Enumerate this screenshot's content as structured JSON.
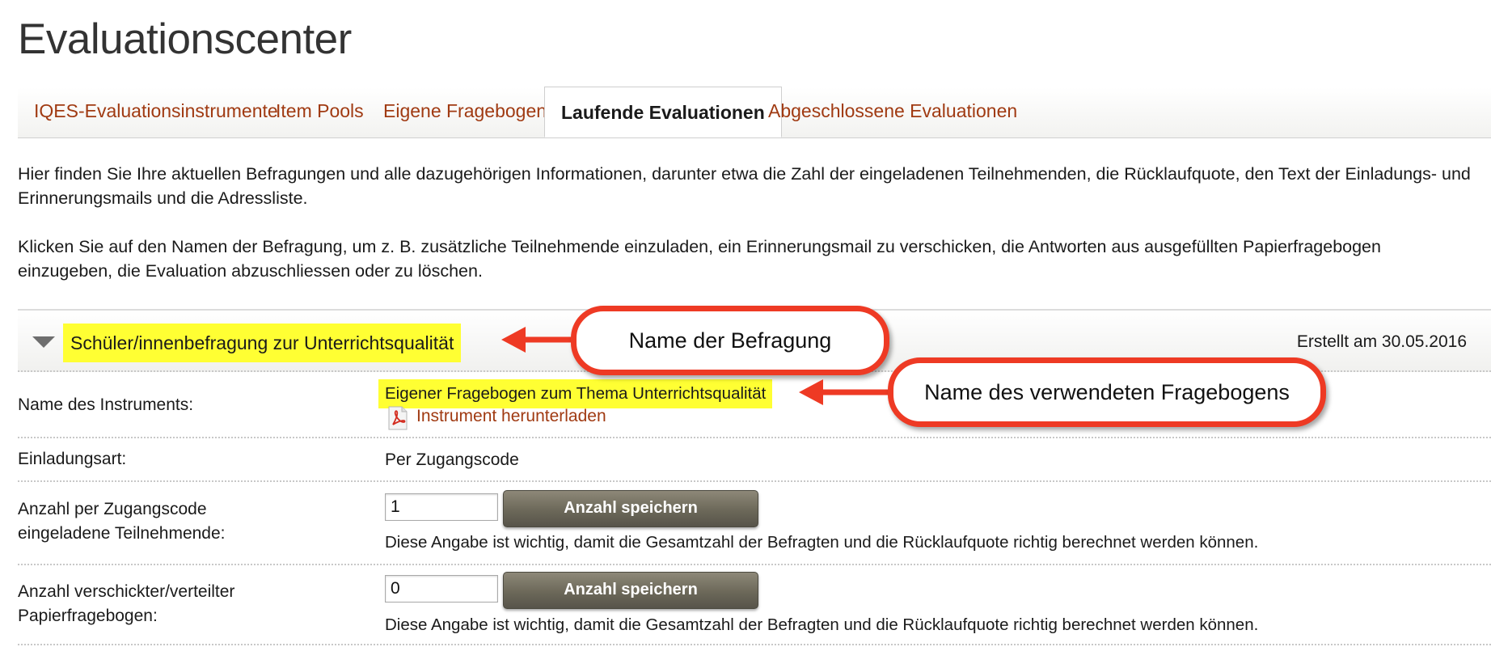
{
  "page": {
    "title": "Evaluationscenter"
  },
  "tabs": [
    {
      "label": "IQES-Evaluationsinstrumente",
      "active": false
    },
    {
      "label": "Item Pools",
      "active": false
    },
    {
      "label": "Eigene Fragebogen",
      "active": false
    },
    {
      "label": "Laufende Evaluationen",
      "active": true
    },
    {
      "label": "Abgeschlossene Evaluationen",
      "active": false
    }
  ],
  "intro": {
    "paragraph1": "Hier finden Sie Ihre aktuellen Befragungen und alle dazugehörigen Informationen, darunter etwa die Zahl der eingeladenen Teilnehmenden, die Rücklaufquote, den Text der Einladungs- und Erinnerungsmails und die Adressliste.",
    "paragraph2": "Klicken Sie auf den Namen der Befragung, um z. B. zusätzliche Teilnehmende einzuladen, ein Erinnerungsmail zu verschicken, die Antworten aus ausgefüllten Papierfragebogen einzugeben, die Evaluation abzuschliessen oder zu löschen."
  },
  "survey": {
    "name": "Schüler/innenbefragung zur Unterrichtsqualität",
    "created": "Erstellt am 30.05.2016",
    "instrument_label": "Name des Instruments:",
    "instrument_name": "Eigener Fragebogen zum Thema Unterrichtsqualität",
    "download_link": "Instrument herunterladen",
    "invitation_label": "Einladungsart:",
    "invitation_value": "Per Zugangscode",
    "code_label_line1": "Anzahl per Zugangscode",
    "code_label_line2": "eingeladene Teilnehmende:",
    "code_count": "1",
    "paper_label_line1": "Anzahl verschickter/verteilter",
    "paper_label_line2": "Papierfragebogen:",
    "paper_count": "0",
    "save_button": "Anzahl speichern",
    "hint": "Diese Angabe ist wichtig, damit die Gesamtzahl der Befragten und die Rücklaufquote richtig berechnet werden können."
  },
  "annotations": {
    "callout1": "Name der Befragung",
    "callout2": "Name des verwendeten Fragebogens"
  },
  "colors": {
    "link": "#a03a12",
    "highlight": "#ffff33",
    "callout_border": "#ee3a24",
    "button": "#6c6859"
  },
  "icons": {
    "download": "pdf-icon",
    "collapse": "caret-down-icon"
  }
}
